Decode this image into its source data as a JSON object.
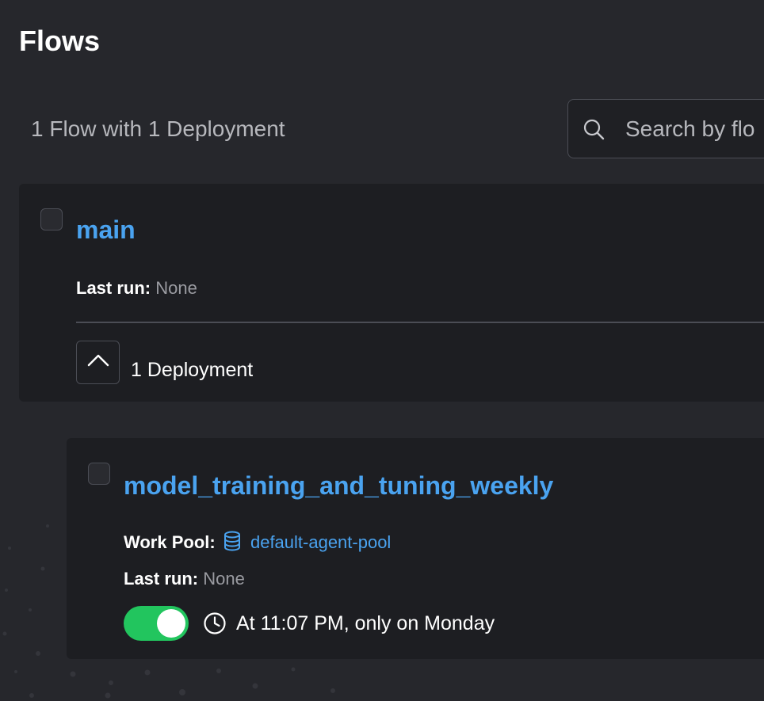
{
  "page": {
    "title": "Flows",
    "summary": "1 Flow with 1 Deployment"
  },
  "search": {
    "placeholder": "Search by flo",
    "icon": "search-icon"
  },
  "flow": {
    "name": "main",
    "last_run_label": "Last run:",
    "last_run_value": "None",
    "deployments_label": "1 Deployment",
    "collapse_icon": "chevron-up-icon"
  },
  "deployment": {
    "name": "model_training_and_tuning_weekly",
    "work_pool_label": "Work Pool:",
    "work_pool_value": "default-agent-pool",
    "work_pool_icon": "database-icon",
    "last_run_label": "Last run:",
    "last_run_value": "None",
    "schedule_active": true,
    "schedule_text": "At 11:07 PM, only on Monday",
    "schedule_icon": "clock-icon"
  },
  "colors": {
    "background": "#26272c",
    "card": "#1d1e22",
    "link": "#4aa3f0",
    "toggle_on": "#22c55e"
  }
}
